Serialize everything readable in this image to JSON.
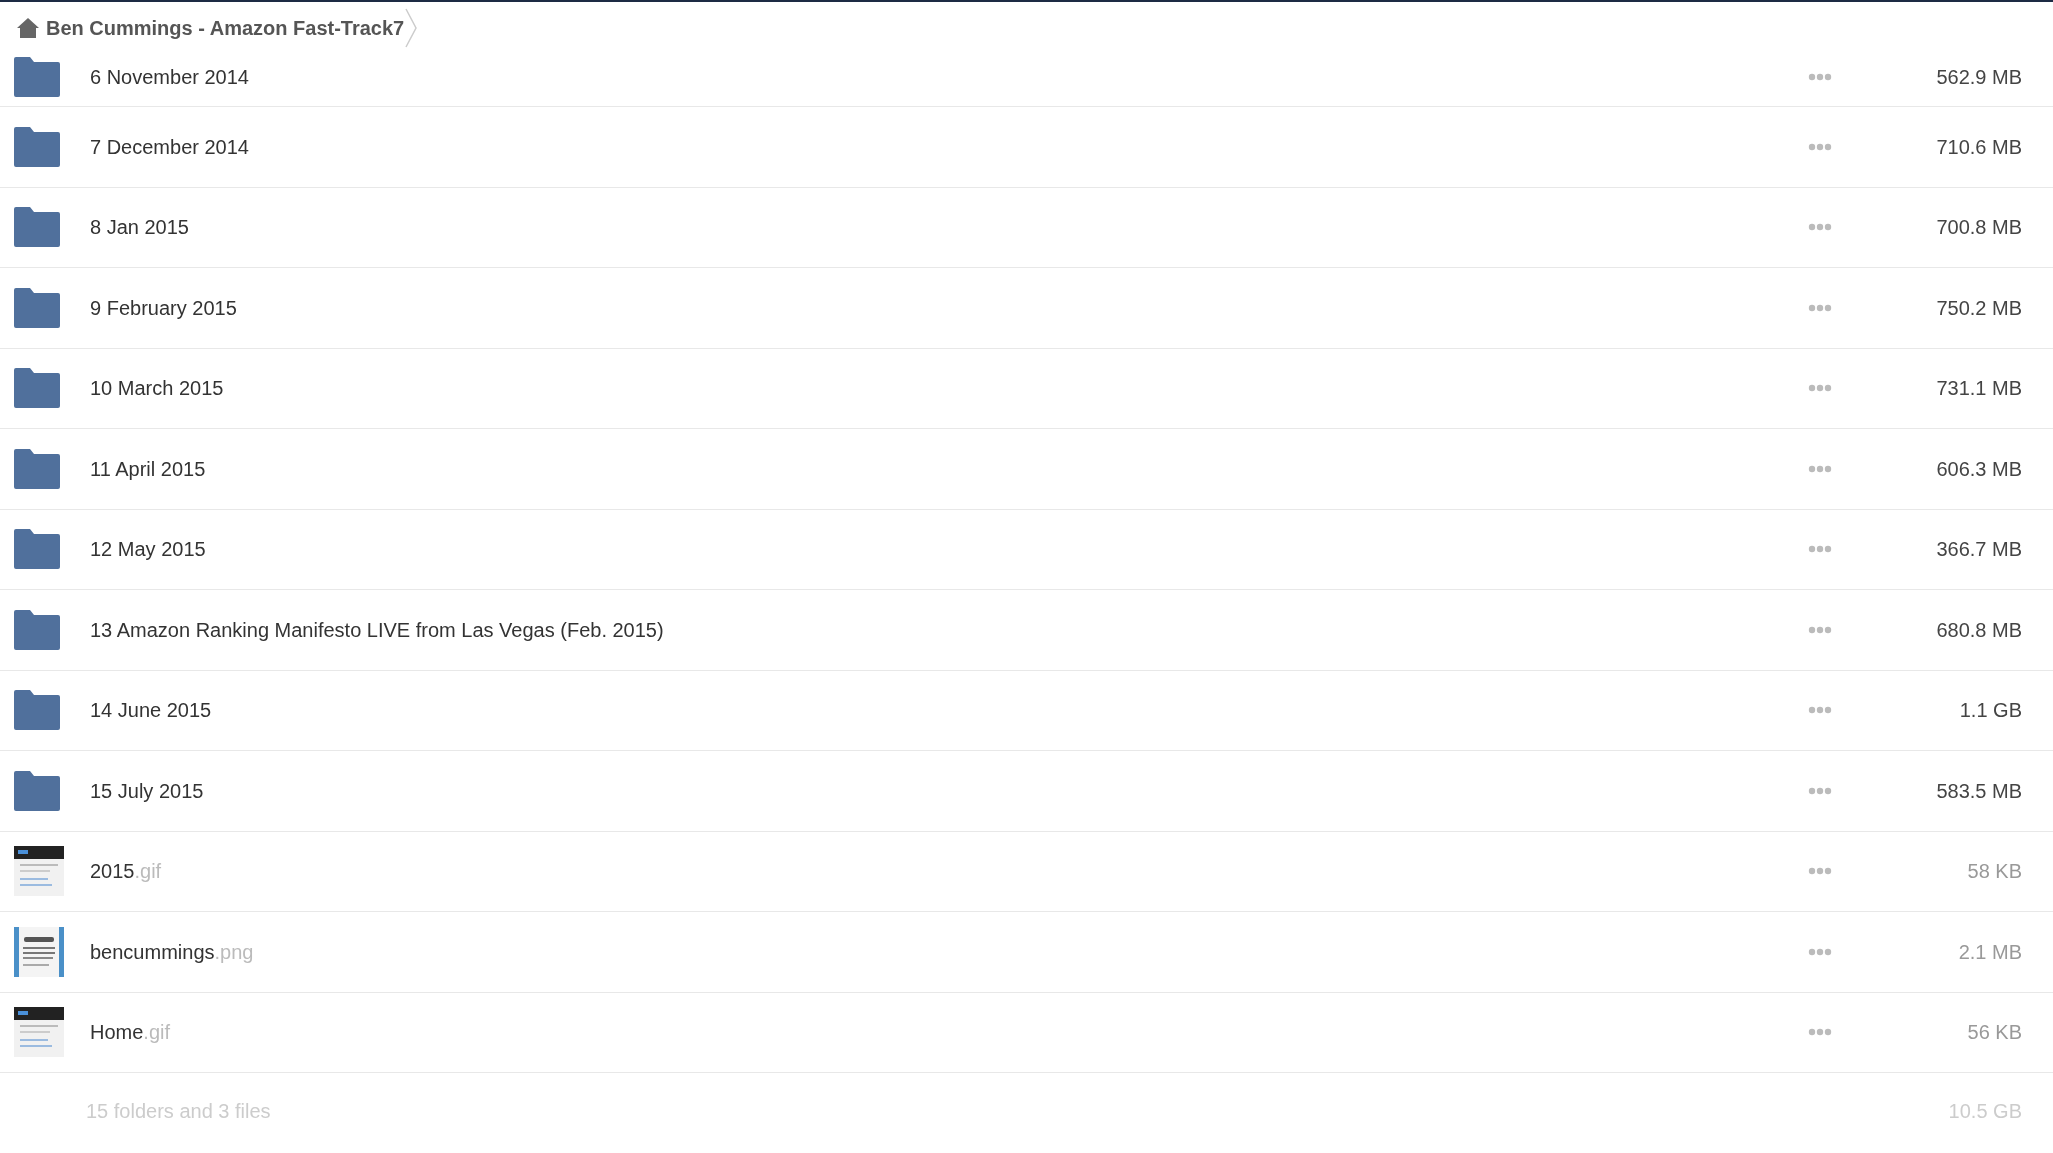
{
  "breadcrumb": {
    "title": "Ben Cummings - Amazon Fast-Track7"
  },
  "items": [
    {
      "kind": "folder",
      "name": "6 November 2014",
      "size": "562.9 MB"
    },
    {
      "kind": "folder",
      "name": "7 December 2014",
      "size": "710.6 MB"
    },
    {
      "kind": "folder",
      "name": "8 Jan 2015",
      "size": "700.8 MB"
    },
    {
      "kind": "folder",
      "name": "9 February 2015",
      "size": "750.2 MB"
    },
    {
      "kind": "folder",
      "name": "10 March 2015",
      "size": "731.1 MB"
    },
    {
      "kind": "folder",
      "name": "11 April 2015",
      "size": "606.3 MB"
    },
    {
      "kind": "folder",
      "name": "12 May 2015",
      "size": "366.7 MB"
    },
    {
      "kind": "folder",
      "name": "13 Amazon Ranking Manifesto LIVE from Las Vegas (Feb. 2015)",
      "size": "680.8 MB"
    },
    {
      "kind": "folder",
      "name": "14 June 2015",
      "size": "1.1 GB"
    },
    {
      "kind": "folder",
      "name": "15 July 2015",
      "size": "583.5 MB"
    },
    {
      "kind": "image",
      "color": "#222222",
      "name": "2015",
      "extension": ".gif",
      "size": "58 KB"
    },
    {
      "kind": "image",
      "color": "#4a90c8",
      "name": "bencummings",
      "extension": ".png",
      "size": "2.1 MB"
    },
    {
      "kind": "image",
      "color": "#222222",
      "name": "Home",
      "extension": ".gif",
      "size": "56 KB"
    }
  ],
  "summary": {
    "count": "15 folders and 3 files",
    "total": "10.5 GB"
  }
}
